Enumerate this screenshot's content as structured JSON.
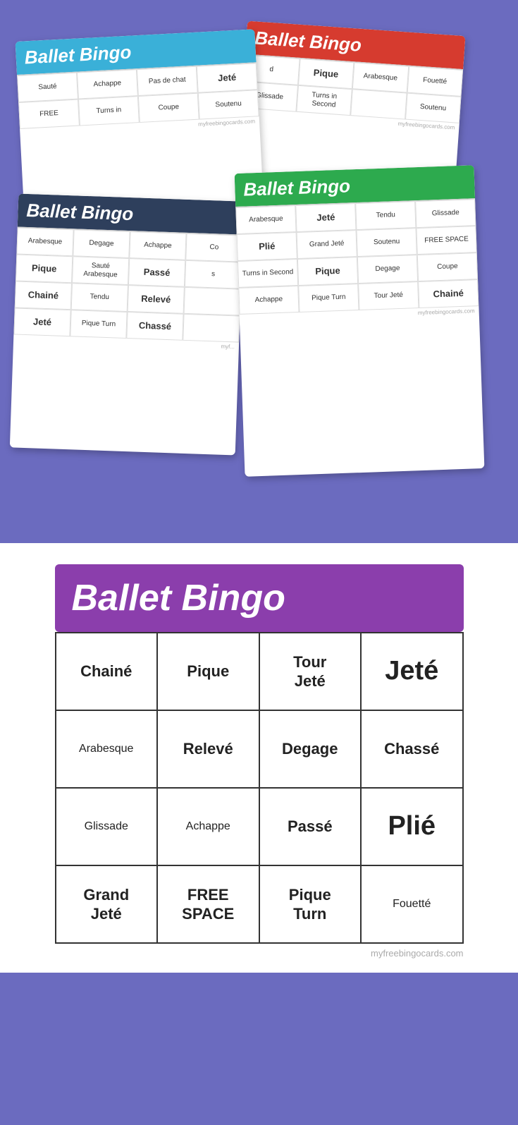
{
  "background": "#6b6bbf",
  "mini_cards": [
    {
      "id": "card1",
      "header_color": "blue",
      "header_label": "Ballet Bingo",
      "rows": [
        [
          "Sauté",
          "Achappe",
          "Pas de chat",
          "Jeté"
        ],
        [
          "FREE",
          "Turns in",
          "Coupe",
          "Soutenu"
        ]
      ]
    },
    {
      "id": "card2",
      "header_color": "red",
      "header_label": "Ballet Bingo",
      "rows": [
        [
          "d",
          "Pique",
          "Arabesque",
          "Fouetté"
        ],
        [
          "Glissade",
          "Turns in Second",
          "",
          "Soutenu"
        ]
      ]
    },
    {
      "id": "card3",
      "header_color": "dark",
      "header_label": "Ballet Bingo",
      "rows": [
        [
          "Arabesque",
          "Degage",
          "Achappe",
          "Co"
        ],
        [
          "Pique",
          "Sauté Arabesque",
          "Passé",
          "s"
        ],
        [
          "Chainé",
          "Tendu",
          "Relevé",
          ""
        ],
        [
          "Jeté",
          "Pique Turn",
          "Chassé",
          ""
        ]
      ]
    },
    {
      "id": "card4",
      "header_color": "green",
      "header_label": "Ballet Bingo",
      "rows": [
        [
          "Arabesque",
          "Jeté",
          "Tendu",
          "Glissade"
        ],
        [
          "Plié",
          "Grand Jeté",
          "Soutenu",
          "FREE SPACE"
        ],
        [
          "Turns in Second",
          "Pique",
          "Degage",
          "Coupe"
        ],
        [
          "Achappe",
          "Pique Turn",
          "Tour Jeté",
          "Chainé"
        ]
      ]
    }
  ],
  "large_card": {
    "header_label": "Ballet Bingo",
    "rows": [
      [
        {
          "text": "Chainé",
          "size": "md"
        },
        {
          "text": "Pique",
          "size": "md"
        },
        {
          "text": "Tour Jeté",
          "size": "md"
        },
        {
          "text": "Jeté",
          "size": "xl"
        }
      ],
      [
        {
          "text": "Arabesque",
          "size": "sm"
        },
        {
          "text": "Relevé",
          "size": "md"
        },
        {
          "text": "Degage",
          "size": "md"
        },
        {
          "text": "Chassé",
          "size": "md"
        }
      ],
      [
        {
          "text": "Glissade",
          "size": "sm"
        },
        {
          "text": "Achappe",
          "size": "sm"
        },
        {
          "text": "Passé",
          "size": "md"
        },
        {
          "text": "Plié",
          "size": "xl"
        }
      ],
      [
        {
          "text": "Grand Jeté",
          "size": "md"
        },
        {
          "text": "FREE SPACE",
          "size": "md"
        },
        {
          "text": "Pique Turn",
          "size": "md"
        },
        {
          "text": "Fouetté",
          "size": "sm"
        }
      ]
    ],
    "footer": "myfreebingocards.com"
  },
  "footer_mini": "myfreebingocards.com"
}
